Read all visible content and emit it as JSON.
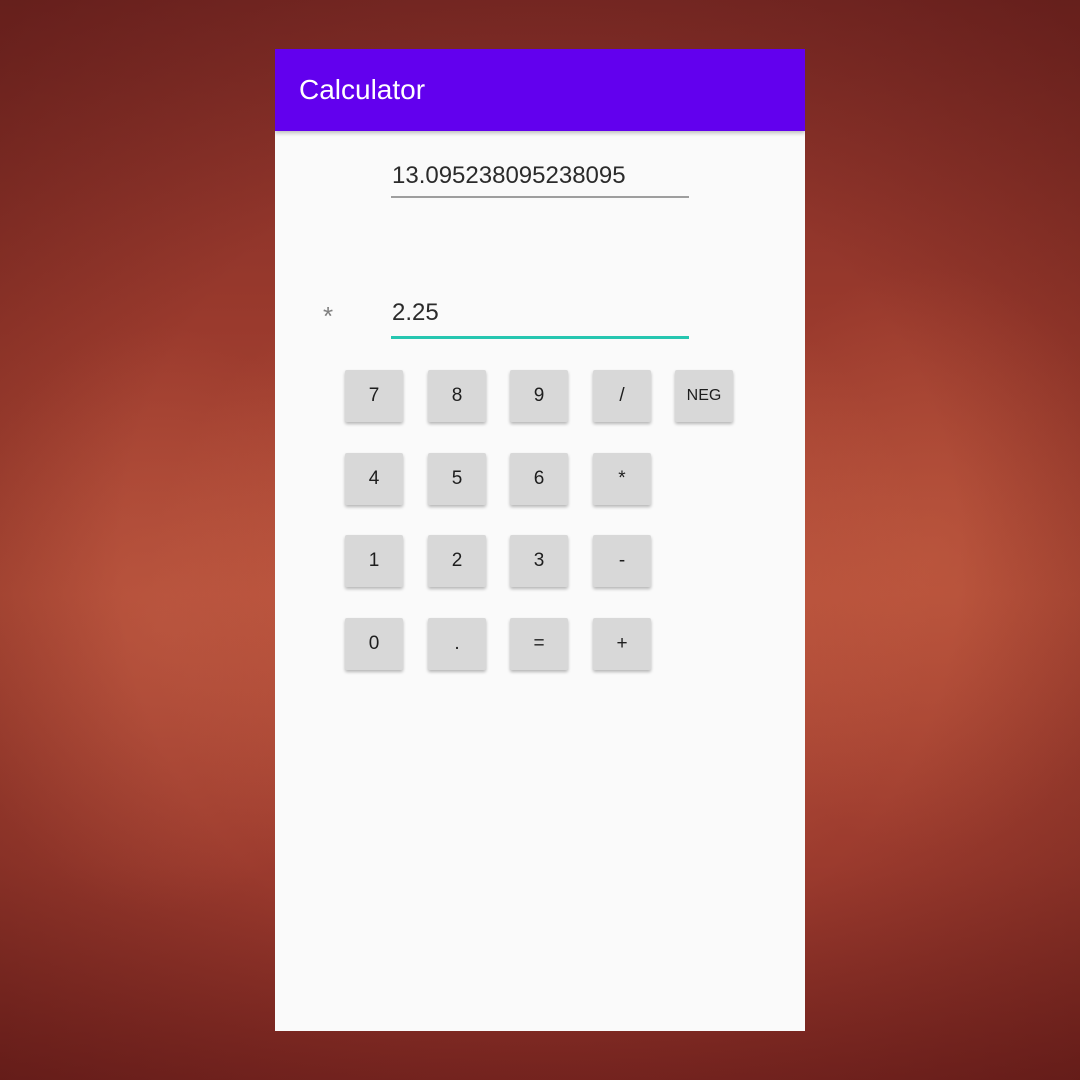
{
  "app": {
    "title": "Calculator"
  },
  "display": {
    "result": "13.095238095238095",
    "operator": "*",
    "operand": "2.25"
  },
  "keypad": {
    "row1": [
      "7",
      "8",
      "9",
      "/",
      "NEG"
    ],
    "row2": [
      "4",
      "5",
      "6",
      "*"
    ],
    "row3": [
      "1",
      "2",
      "3",
      "-"
    ],
    "row4": [
      "0",
      ".",
      "=",
      "+"
    ]
  },
  "colors": {
    "app_bar": "#6200ee",
    "accent": "#26c6b0",
    "key_background": "#d8d8d8"
  }
}
